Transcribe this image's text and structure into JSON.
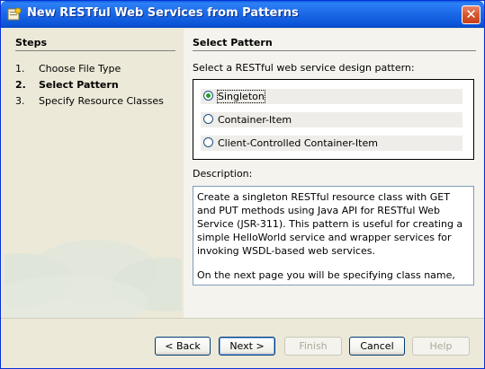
{
  "window": {
    "title": "New RESTful Web Services from Patterns"
  },
  "steps": {
    "heading": "Steps",
    "items": [
      {
        "num": "1.",
        "label": "Choose File Type",
        "active": false
      },
      {
        "num": "2.",
        "label": "Select Pattern",
        "active": true
      },
      {
        "num": "3.",
        "label": "Specify Resource Classes",
        "active": false
      }
    ]
  },
  "main": {
    "heading": "Select Pattern",
    "prompt": "Select a RESTful web service design pattern:",
    "patterns": [
      {
        "label": "Singleton",
        "selected": true
      },
      {
        "label": "Container-Item",
        "selected": false
      },
      {
        "label": "Client-Controlled Container-Item",
        "selected": false
      }
    ],
    "description_label": "Description:",
    "description_p1": "Create a singleton RESTful resource class with GET and PUT methods using Java API for RESTful Web Service (JSR-311). This pattern is useful for creating a simple HelloWorld service and wrapper services for invoking WSDL-based web services.",
    "description_p2": "On the next page you will be specifying class name, URI, and representation type of the resource."
  },
  "buttons": {
    "back": "< Back",
    "next": "Next >",
    "finish": "Finish",
    "cancel": "Cancel",
    "help": "Help"
  }
}
